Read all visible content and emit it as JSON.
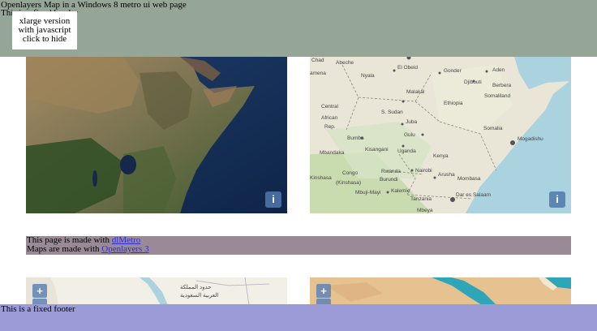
{
  "header": {
    "title": "Openlayers Map in a Windows 8 metro ui web page",
    "subtitle": "This is a fixed header",
    "background": "#95a696"
  },
  "popup": {
    "lines": [
      "xlarge version",
      "with javascript",
      "click to hide"
    ]
  },
  "maps": {
    "info_label": "i",
    "zoom_in_label": "+",
    "osm_labels": [
      "Chad",
      "Abeche",
      "El Obeid",
      "Gonder",
      "Aden",
      "Nyala",
      "Djibouti",
      "Berbera",
      "Malakal",
      "Somaliland",
      "Central",
      "S. Sudan",
      "Ethiopia",
      "African",
      "Rep.",
      "Juba",
      "Somalia",
      "Bumba",
      "Gulu",
      "Mogadishu",
      "Mbandaka",
      "Kisangani",
      "Uganda",
      "Kenya",
      "Congo",
      "Rwanda",
      "Nairobi",
      "(Kinshasa)",
      "Burundi",
      "Arusha",
      "Mombasa",
      "Mbuji-Mayi",
      "Kalemie",
      "Tanzania",
      "Dar es Salaam",
      "Mbeya",
      "Kinshasa",
      "amena"
    ],
    "arabic_labels": [
      "حدود المملكة",
      "العربية السعودية"
    ]
  },
  "credits": {
    "made_prefix": "This page is made with ",
    "made_link": "dlMetro",
    "maps_prefix": "Maps are made with ",
    "maps_link": "Openlayers 3",
    "background": "#9a8a96"
  },
  "footer": {
    "text": "This is a fixed footer",
    "background": "#9b9bd8"
  }
}
